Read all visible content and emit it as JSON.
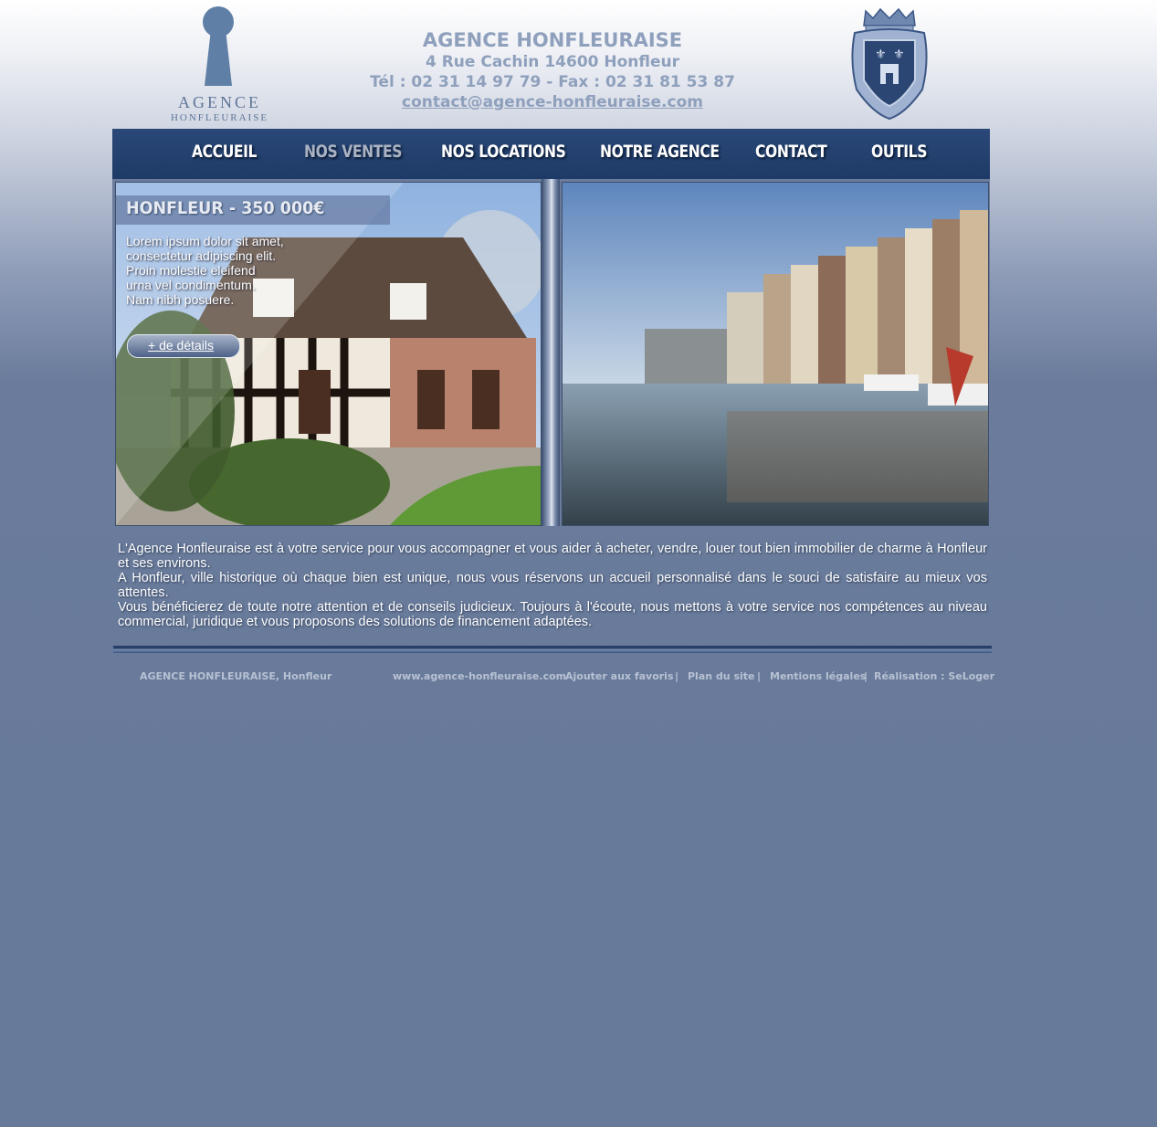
{
  "header": {
    "logo": {
      "line1": "AGENCE",
      "line2": "HONFLEURAISE"
    },
    "agency_name": "AGENCE HONFLEURAISE",
    "address": "4 Rue Cachin 14600 Honfleur",
    "phone_fax": "Tél : 02 31 14 97 79 - Fax : 02 31 81 53 87",
    "email": "contact@agence-honfleuraise.com",
    "crest_icon": "honfleur-coat-of-arms-icon"
  },
  "nav": {
    "items": [
      {
        "label": "ACCUEIL"
      },
      {
        "label": "NOS VENTES",
        "active": true
      },
      {
        "label": "NOS LOCATIONS"
      },
      {
        "label": "NOTRE AGENCE"
      },
      {
        "label": "CONTACT"
      },
      {
        "label": "OUTILS"
      }
    ]
  },
  "feature": {
    "title": "HONFLEUR - 350 000€",
    "lines": [
      "Lorem ipsum dolor sit amet,",
      "consectetur adipiscing elit.",
      "Proin molestie eleifend",
      "urna vel condimentum.",
      "Nam nibh posuere."
    ],
    "button_label": "+ de détails"
  },
  "intro": {
    "paragraphs": [
      "L'Agence Honfleuraise est à votre service pour vous accompagner et vous aider à acheter, vendre, louer tout bien immobilier de charme à Honfleur et ses environs.",
      "A Honfleur, ville historique où chaque bien est unique, nous vous réservons un accueil personnalisé dans le souci de satisfaire au mieux vos attentes.",
      "Vous bénéficierez de toute notre attention et de conseils judicieux. Toujours à l'écoute, nous mettons à votre service nos compétences au niveau commercial, juridique et vous proposons des solutions de financement adaptées."
    ]
  },
  "footer": {
    "left": "AGENCE HONFLEURAISE, Honfleur",
    "site": "www.agence-honfleuraise.com",
    "favorites": "Ajouter aux favoris",
    "sitemap": "Plan du site",
    "legal": "Mentions légales",
    "credit": "Réalisation : SeLoger",
    "separator": "|"
  },
  "colors": {
    "nav_bg": "#1e3a66",
    "page_bg": "#677a9a",
    "header_text": "#8fa0bd"
  }
}
